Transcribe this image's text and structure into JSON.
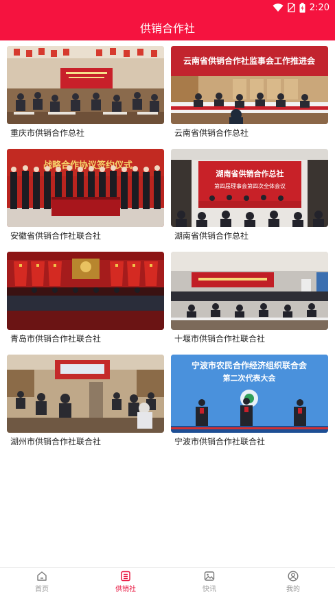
{
  "status_bar": {
    "time": "2:20",
    "icons": [
      "wifi-icon",
      "no-sim-icon",
      "battery-icon"
    ]
  },
  "header": {
    "title": "供销合作社"
  },
  "cards": [
    {
      "caption": "重庆市供销合作总社",
      "photo": "conference-room-photo"
    },
    {
      "caption": "云南省供销合作总社",
      "photo": "supervisory-meeting-photo",
      "photo_text": "云南省供销合作社监事会工作推进会"
    },
    {
      "caption": "安徽省供销合作社联合社",
      "photo": "signing-ceremony-photo",
      "photo_text": "战略合作协议签约仪式"
    },
    {
      "caption": "湖南省供销合作总社",
      "photo": "council-meeting-photo",
      "photo_text": "湖南省供销合作总社",
      "photo_subtext": "第四届理事会第四次全体会议"
    },
    {
      "caption": "青岛市供销合作社联合社",
      "photo": "stage-with-flags-photo"
    },
    {
      "caption": "十堰市供销合作社联合社",
      "photo": "hall-meeting-photo"
    },
    {
      "caption": "湖州市供销合作社联合社",
      "photo": "training-room-photo"
    },
    {
      "caption": "宁波市供销合作社联合社",
      "photo": "congress-stage-photo",
      "photo_text": "宁波市农民合作经济组织联合会",
      "photo_subtext": "第二次代表大会"
    }
  ],
  "tabs": [
    {
      "label": "首页",
      "icon": "home-icon",
      "active": false
    },
    {
      "label": "供销社",
      "icon": "list-doc-icon",
      "active": true
    },
    {
      "label": "快讯",
      "icon": "image-icon",
      "active": false
    },
    {
      "label": "我的",
      "icon": "user-icon",
      "active": false
    }
  ],
  "colors": {
    "brand": "#f5133f",
    "active_tab": "#e8153f",
    "inactive_tab": "#999999"
  }
}
